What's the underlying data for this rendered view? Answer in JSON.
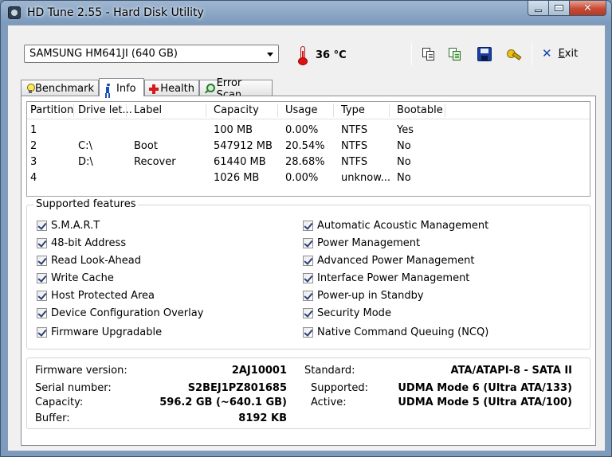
{
  "window": {
    "title": "HD Tune 2.55 - Hard Disk Utility"
  },
  "toolbar": {
    "drive": "SAMSUNG HM641JI (640 GB)",
    "temperature": "36 °C",
    "icons": [
      "copy-text-icon",
      "copy-screenshot-icon",
      "save-icon",
      "options-icon"
    ],
    "exit_label_underline": "E",
    "exit_label_rest": "xit"
  },
  "tabs": [
    {
      "label": "Benchmark",
      "icon": "bulb-icon"
    },
    {
      "label": "Info",
      "icon": "info-icon",
      "active": true
    },
    {
      "label": "Health",
      "icon": "health-plus-icon"
    },
    {
      "label": "Error Scan",
      "icon": "magnifier-icon"
    }
  ],
  "partitions": {
    "columns": [
      "Partition",
      "Drive let...",
      "Label",
      "Capacity",
      "Usage",
      "Type",
      "Bootable"
    ],
    "rows": [
      [
        "1",
        "",
        "",
        "100 MB",
        "0.00%",
        "NTFS",
        "Yes"
      ],
      [
        "2",
        "C:\\",
        "Boot",
        "547912 MB",
        "20.54%",
        "NTFS",
        "No"
      ],
      [
        "3",
        "D:\\",
        "Recover",
        "61440 MB",
        "28.68%",
        "NTFS",
        "No"
      ],
      [
        "4",
        "",
        "",
        "1026 MB",
        "0.00%",
        "unknow...",
        "No"
      ]
    ]
  },
  "features": {
    "title": "Supported features",
    "left": [
      {
        "label": "S.M.A.R.T",
        "checked": true
      },
      {
        "label": "48-bit Address",
        "checked": true
      },
      {
        "label": "Read Look-Ahead",
        "checked": true
      },
      {
        "label": "Write Cache",
        "checked": true
      },
      {
        "label": "Host Protected Area",
        "checked": true
      },
      {
        "label": "Device Configuration Overlay",
        "checked": true
      },
      {
        "label": "Firmware Upgradable",
        "checked": true
      }
    ],
    "right": [
      {
        "label": "Automatic Acoustic Management",
        "checked": true
      },
      {
        "label": "Power Management",
        "checked": true
      },
      {
        "label": "Advanced Power Management",
        "checked": true
      },
      {
        "label": "Interface Power Management",
        "checked": true
      },
      {
        "label": "Power-up in Standby",
        "checked": true
      },
      {
        "label": "Security Mode",
        "checked": true
      },
      {
        "label": "Native Command Queuing (NCQ)",
        "checked": true
      }
    ]
  },
  "details": {
    "firmware_label": "Firmware version:",
    "firmware_value": "2AJ10001",
    "serial_label": "Serial number:",
    "serial_value": "S2BEJ1PZ801685",
    "capacity_label": "Capacity:",
    "capacity_value": "596.2 GB (~640.1 GB)",
    "buffer_label": "Buffer:",
    "buffer_value": "8192 KB",
    "standard_label": "Standard:",
    "standard_value": "ATA/ATAPI-8 - SATA II",
    "supported_label": "Supported:",
    "supported_value": "UDMA Mode 6 (Ultra ATA/133)",
    "active_label": "Active:",
    "active_value": "UDMA Mode 5 (Ultra ATA/100)"
  }
}
